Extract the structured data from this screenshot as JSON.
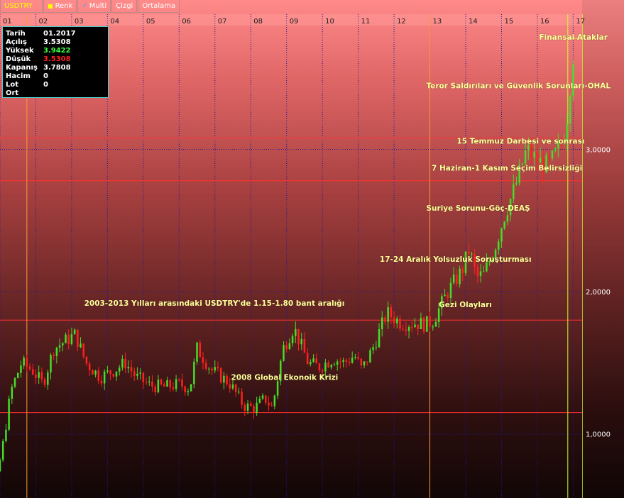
{
  "toolbar": {
    "symbol": "USDTRY",
    "buttons": [
      {
        "label": "Renk",
        "marker": "square"
      },
      {
        "label": "Multi",
        "marker": "check"
      },
      {
        "label": "Çizgi",
        "marker": ""
      },
      {
        "label": "Ortalama",
        "marker": ""
      }
    ]
  },
  "info_box": {
    "rows": [
      {
        "label": "Tarih",
        "value": "01.2017",
        "color": "#ffffff"
      },
      {
        "label": "Açılış",
        "value": "3.5308",
        "color": "#ffffff"
      },
      {
        "label": "Yüksek",
        "value": "3.9422",
        "color": "#3cff3c"
      },
      {
        "label": "Düşük",
        "value": "3.5308",
        "color": "#ff2020"
      },
      {
        "label": "Kapanış",
        "value": "3.7808",
        "color": "#ffffff"
      },
      {
        "label": "Hacim",
        "value": "0",
        "color": "#ffffff"
      },
      {
        "label": "Lot",
        "value": "0",
        "color": "#ffffff"
      },
      {
        "label": "Ort",
        "value": "",
        "color": "#ffffff"
      }
    ]
  },
  "colors": {
    "up": "#44dd2a",
    "down": "#ff2020",
    "annotation": "#ffff99",
    "level_line": "#ff3030",
    "year_line": "#1a1a99",
    "marker_line": "#ff9933",
    "axis_text": "#ffffff",
    "current_line": "#ccff33"
  },
  "chart_data": {
    "type": "candlestick",
    "symbol": "USDTRY",
    "x_tick_labels": [
      "01",
      "02",
      "03",
      "04",
      "05",
      "06",
      "07",
      "08",
      "09",
      "10",
      "11",
      "12",
      "13",
      "14",
      "15",
      "16",
      "17"
    ],
    "y_tick_labels": [
      "1,0000",
      "2,0000",
      "3,0000"
    ],
    "y_ticks": [
      1.0,
      2.0,
      3.0
    ],
    "ylim": [
      0.55,
      3.95
    ],
    "xlim": [
      2001.0,
      2017.25
    ],
    "horizontal_levels": [
      1.15,
      1.8,
      2.78,
      3.08
    ],
    "vertical_markers": [
      2001.75,
      2013.0,
      2016.85
    ],
    "anchors": [
      [
        2000.0,
        0.6
      ],
      [
        2000.6,
        0.66
      ],
      [
        2000.9,
        0.68
      ],
      [
        2001.1,
        0.95
      ],
      [
        2001.3,
        1.3
      ],
      [
        2001.6,
        1.5
      ],
      [
        2001.9,
        1.45
      ],
      [
        2002.2,
        1.35
      ],
      [
        2002.5,
        1.6
      ],
      [
        2002.8,
        1.65
      ],
      [
        2003.1,
        1.7
      ],
      [
        2003.4,
        1.5
      ],
      [
        2003.8,
        1.4
      ],
      [
        2004.2,
        1.45
      ],
      [
        2004.5,
        1.5
      ],
      [
        2004.8,
        1.4
      ],
      [
        2005.2,
        1.34
      ],
      [
        2005.6,
        1.33
      ],
      [
        2006.0,
        1.35
      ],
      [
        2006.3,
        1.32
      ],
      [
        2006.5,
        1.6
      ],
      [
        2006.9,
        1.45
      ],
      [
        2007.4,
        1.36
      ],
      [
        2007.8,
        1.2
      ],
      [
        2008.1,
        1.18
      ],
      [
        2008.4,
        1.25
      ],
      [
        2008.6,
        1.18
      ],
      [
        2008.9,
        1.6
      ],
      [
        2009.2,
        1.75
      ],
      [
        2009.6,
        1.5
      ],
      [
        2009.9,
        1.47
      ],
      [
        2010.3,
        1.53
      ],
      [
        2010.6,
        1.5
      ],
      [
        2010.9,
        1.55
      ],
      [
        2011.1,
        1.45
      ],
      [
        2011.4,
        1.6
      ],
      [
        2011.8,
        1.85
      ],
      [
        2012.2,
        1.78
      ],
      [
        2012.6,
        1.78
      ],
      [
        2012.9,
        1.77
      ],
      [
        2013.1,
        1.8
      ],
      [
        2013.5,
        2.0
      ],
      [
        2013.9,
        2.15
      ],
      [
        2014.1,
        2.3
      ],
      [
        2014.3,
        2.1
      ],
      [
        2014.5,
        2.12
      ],
      [
        2014.8,
        2.3
      ],
      [
        2015.1,
        2.55
      ],
      [
        2015.4,
        2.75
      ],
      [
        2015.7,
        3.0
      ],
      [
        2016.0,
        2.92
      ],
      [
        2016.3,
        2.88
      ],
      [
        2016.6,
        3.0
      ],
      [
        2016.8,
        3.15
      ],
      [
        2016.95,
        3.55
      ],
      [
        2017.05,
        3.78
      ]
    ],
    "annotations": [
      {
        "text": "Finansal Ataklar",
        "x": 2016.05,
        "y": 3.77
      },
      {
        "text": "Teror Saldırıları ve Güvenlik Sorunları-OHAL",
        "x": 2012.9,
        "y": 3.43
      },
      {
        "text": "15 Temmuz Darbesi ve sonrası",
        "x": 2013.75,
        "y": 3.04
      },
      {
        "text": "7 Haziran-1 Kasım Seçim Belirsizliği",
        "x": 2013.05,
        "y": 2.85
      },
      {
        "text": "Suriye Sorunu-Göç-DEAŞ",
        "x": 2012.9,
        "y": 2.57
      },
      {
        "text": "17-24 Aralık Yolsuzluk Soruşturması",
        "x": 2011.6,
        "y": 2.21
      },
      {
        "text": "Gezi Olayları",
        "x": 2013.25,
        "y": 1.89
      },
      {
        "text": "2003-2013 Yılları arasındaki USDTRY'de 1.15-1.80 bant aralığı",
        "x": 2003.35,
        "y": 1.9
      },
      {
        "text": "2008 Global Ekonoik Krizi",
        "x": 2007.45,
        "y": 1.38
      }
    ]
  }
}
